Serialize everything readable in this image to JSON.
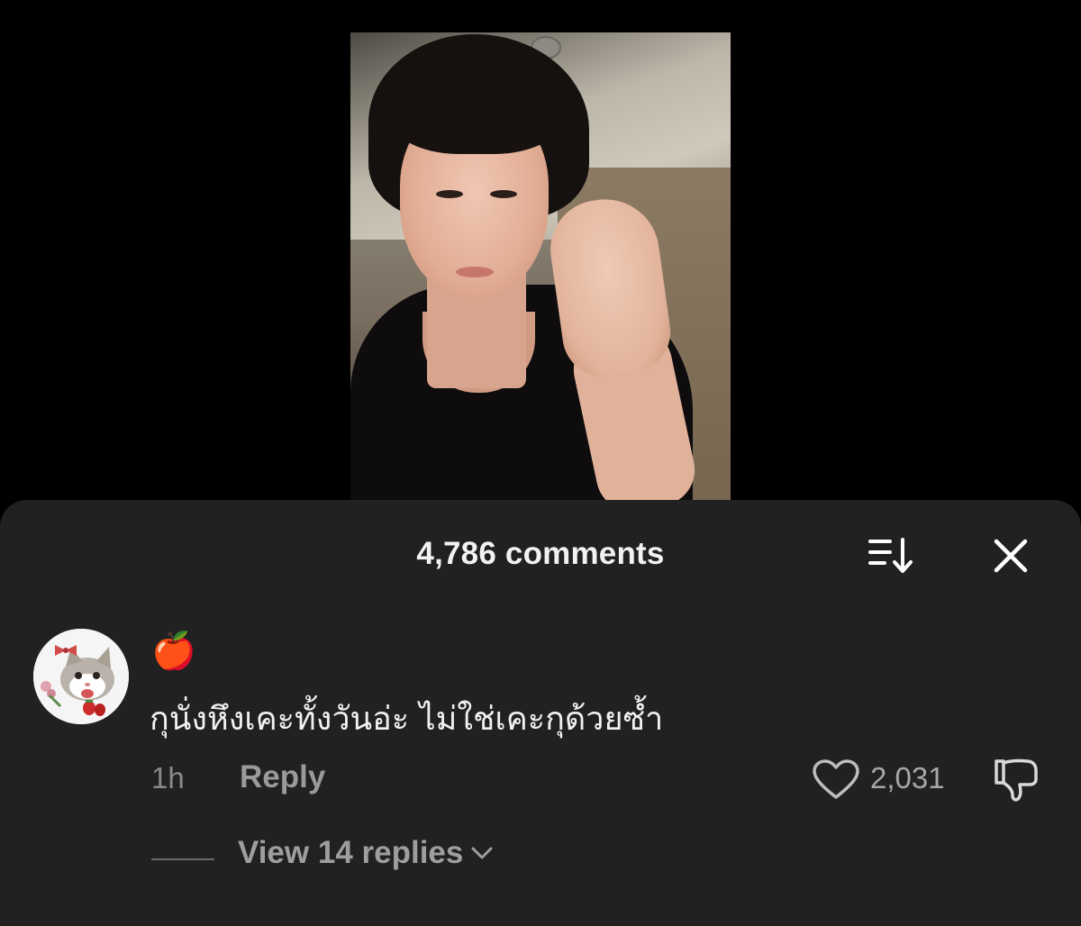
{
  "sheet": {
    "title": "4,786 comments"
  },
  "comment": {
    "username_emoji": "🍎",
    "text": "กุนั่งหึงเคะทั้งวันอ่ะ ไม่ใช่เคะกุด้วยซ้ำ",
    "time": "1h",
    "reply_label": "Reply",
    "like_count": "2,031",
    "view_replies_label": "View 14 replies"
  },
  "colors": {
    "sheet_bg": "#212121",
    "page_bg": "#000000",
    "muted_text": "#9a9a9a",
    "primary_text": "#f1f1f1"
  },
  "icons": {
    "sort": "sort-icon",
    "close": "close-icon",
    "like": "heart-icon",
    "dislike": "thumbs-down-icon",
    "chevron": "chevron-down-icon"
  }
}
